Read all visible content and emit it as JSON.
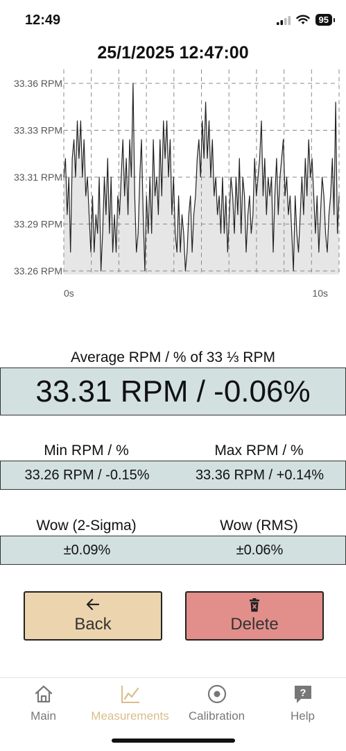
{
  "status_bar": {
    "time": "12:49",
    "battery": "95"
  },
  "timestamp": "25/1/2025 12:47:00",
  "chart_data": {
    "type": "area",
    "title": "",
    "xlabel": "",
    "ylabel": "",
    "x_tick_labels": [
      "0s",
      "10s"
    ],
    "y_tick_labels": [
      "33.36 RPM",
      "33.33 RPM",
      "33.31 RPM",
      "33.29 RPM",
      "33.26 RPM"
    ],
    "xlim": [
      0,
      10
    ],
    "ylim": [
      33.26,
      33.36
    ],
    "grid": true,
    "colors": {
      "line": "#222222",
      "fill": "#e6e6e6",
      "grid": "#888888"
    },
    "series": [
      {
        "values": [
          33.31,
          33.32,
          33.29,
          33.31,
          33.27,
          33.32,
          33.33,
          33.31,
          33.34,
          33.32,
          33.34,
          33.31,
          33.33,
          33.3,
          33.31,
          33.29,
          33.27,
          33.3,
          33.27,
          33.29,
          33.28,
          33.31,
          33.26,
          33.28,
          33.31,
          33.29,
          33.32,
          33.28,
          33.31,
          33.27,
          33.29,
          33.27,
          33.3,
          33.29,
          33.31,
          33.33,
          33.3,
          33.32,
          33.29,
          33.33,
          33.31,
          33.36,
          33.3,
          33.27,
          33.28,
          33.31,
          33.33,
          33.29,
          33.26,
          33.3,
          33.28,
          33.31,
          33.28,
          33.33,
          33.3,
          33.31,
          33.29,
          33.33,
          33.3,
          33.34,
          33.32,
          33.34,
          33.31,
          33.33,
          33.29,
          33.31,
          33.28,
          33.27,
          33.3,
          33.27,
          33.29,
          33.28,
          33.26,
          33.27,
          33.29,
          33.3,
          33.27,
          33.29,
          33.3,
          33.32,
          33.33,
          33.31,
          33.34,
          33.32,
          33.35,
          33.32,
          33.34,
          33.31,
          33.33,
          33.3,
          33.31,
          33.29,
          33.3,
          33.28,
          33.31,
          33.28,
          33.3,
          33.27,
          33.29,
          33.31,
          33.3,
          33.28,
          33.31,
          33.29,
          33.32,
          33.28,
          33.31,
          33.3,
          33.27,
          33.29,
          33.3,
          33.28,
          33.29,
          33.32,
          33.3,
          33.31,
          33.32,
          33.34,
          33.3,
          33.32,
          33.29,
          33.31,
          33.3,
          33.31,
          33.27,
          33.3,
          33.32,
          33.29,
          33.31,
          33.32,
          33.33,
          33.3,
          33.31,
          33.29,
          33.3,
          33.28,
          33.26,
          33.3,
          33.28,
          33.27,
          33.29,
          33.31,
          33.29,
          33.32,
          33.3,
          33.33,
          33.31,
          33.32,
          33.3,
          33.28,
          33.3,
          33.27,
          33.29,
          33.31,
          33.3,
          33.28,
          33.27,
          33.29,
          33.3,
          33.32,
          33.29,
          33.35,
          33.28,
          33.3
        ]
      }
    ]
  },
  "average": {
    "label": "Average RPM / % of 33 ⅓ RPM",
    "value": "33.31 RPM / -0.06%"
  },
  "minmax": {
    "min_label": "Min RPM / %",
    "max_label": "Max RPM / %",
    "min_value": "33.26 RPM / -0.15%",
    "max_value": "33.36 RPM / +0.14%"
  },
  "wow": {
    "sigma_label": "Wow (2-Sigma)",
    "rms_label": "Wow (RMS)",
    "sigma_value": "±0.09%",
    "rms_value": "±0.06%"
  },
  "buttons": {
    "back_icon": "arrow-left-icon",
    "back_label": "Back",
    "delete_icon": "trash-icon",
    "delete_label": "Delete"
  },
  "tabbar": {
    "tabs": [
      {
        "label": "Main",
        "icon": "home-icon"
      },
      {
        "label": "Measurements",
        "icon": "chart-line-icon",
        "active": true
      },
      {
        "label": "Calibration",
        "icon": "target-icon"
      },
      {
        "label": "Help",
        "icon": "help-icon"
      }
    ],
    "active_color": "#d9bd8a",
    "inactive_color": "#777777"
  }
}
